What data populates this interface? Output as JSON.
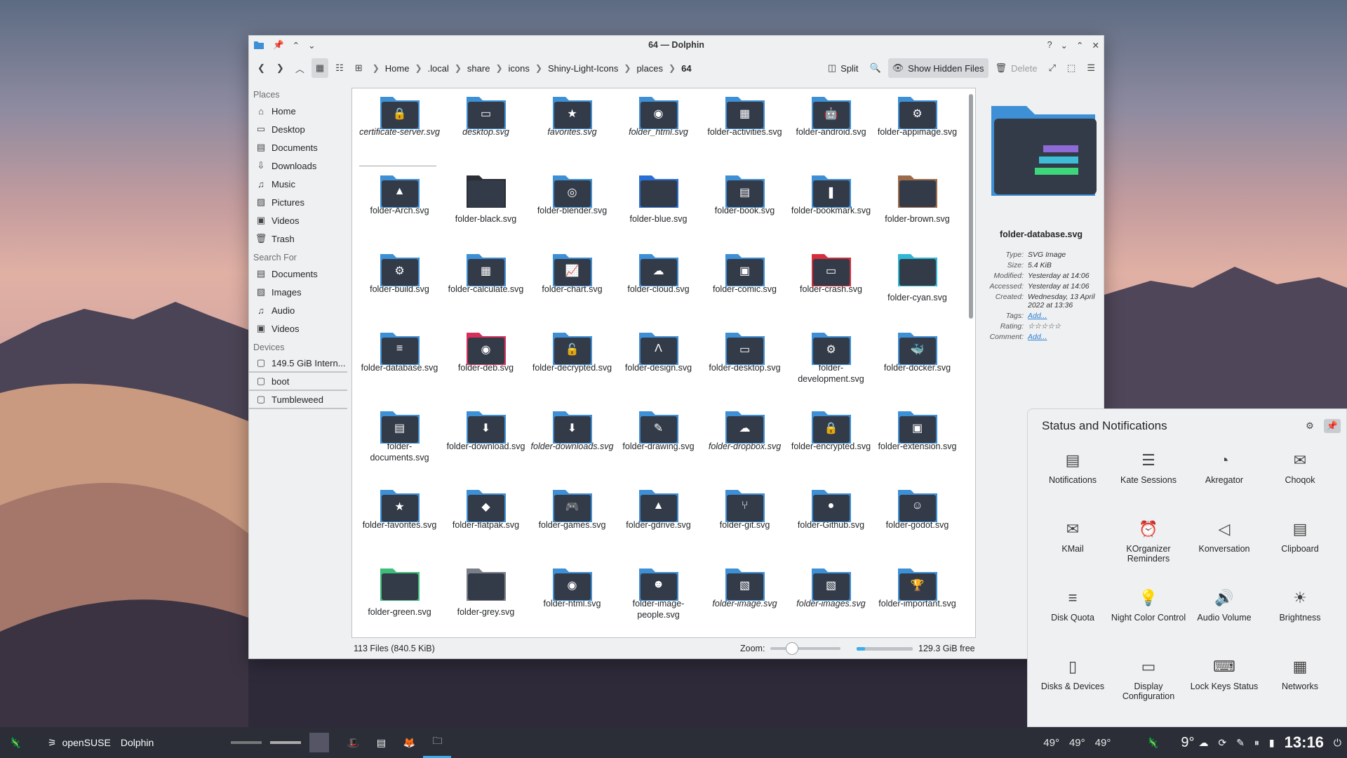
{
  "window": {
    "title": "64 — Dolphin"
  },
  "toolbar": {
    "breadcrumbs": [
      "Home",
      ".local",
      "share",
      "icons",
      "Shiny-Light-Icons",
      "places",
      "64"
    ],
    "split_label": "Split",
    "hidden_label": "Show Hidden Files",
    "delete_label": "Delete"
  },
  "sidebar": {
    "places_header": "Places",
    "places": [
      {
        "label": "Home",
        "icon": "home-icon"
      },
      {
        "label": "Desktop",
        "icon": "desktop-icon"
      },
      {
        "label": "Documents",
        "icon": "documents-icon"
      },
      {
        "label": "Downloads",
        "icon": "download-icon"
      },
      {
        "label": "Music",
        "icon": "music-icon"
      },
      {
        "label": "Pictures",
        "icon": "pictures-icon"
      },
      {
        "label": "Videos",
        "icon": "videos-icon"
      },
      {
        "label": "Trash",
        "icon": "trash-icon"
      }
    ],
    "search_header": "Search For",
    "search": [
      {
        "label": "Documents",
        "icon": "documents-icon"
      },
      {
        "label": "Images",
        "icon": "images-icon"
      },
      {
        "label": "Audio",
        "icon": "audio-icon"
      },
      {
        "label": "Videos",
        "icon": "videos-icon"
      }
    ],
    "devices_header": "Devices",
    "devices": [
      {
        "label": "149.5 GiB Intern..."
      },
      {
        "label": "boot"
      },
      {
        "label": "Tumbleweed"
      }
    ]
  },
  "files": [
    {
      "name": "certificate-server.svg",
      "italic": true,
      "color": "#3d8fd6",
      "glyph": "🔒"
    },
    {
      "name": "desktop.svg",
      "italic": true,
      "color": "#3d8fd6",
      "glyph": "▭"
    },
    {
      "name": "favorites.svg",
      "italic": true,
      "color": "#3d8fd6",
      "glyph": "★"
    },
    {
      "name": "folder_html.svg",
      "italic": true,
      "color": "#3d8fd6",
      "glyph": "◉"
    },
    {
      "name": "folder-activities.svg",
      "italic": false,
      "color": "#3d8fd6",
      "glyph": "▦"
    },
    {
      "name": "folder-android.svg",
      "italic": false,
      "color": "#3d8fd6",
      "glyph": "🤖"
    },
    {
      "name": "folder-appimage.svg",
      "italic": false,
      "color": "#3d8fd6",
      "glyph": "⚙"
    },
    {
      "name": "folder-Arch.svg",
      "italic": false,
      "color": "#3d8fd6",
      "glyph": "▲"
    },
    {
      "name": "folder-black.svg",
      "italic": false,
      "color": "#2b2e37",
      "glyph": ""
    },
    {
      "name": "folder-blender.svg",
      "italic": false,
      "color": "#3d8fd6",
      "glyph": "◎"
    },
    {
      "name": "folder-blue.svg",
      "italic": false,
      "color": "#2a6fd6",
      "glyph": ""
    },
    {
      "name": "folder-book.svg",
      "italic": false,
      "color": "#3d8fd6",
      "glyph": "▤"
    },
    {
      "name": "folder-bookmark.svg",
      "italic": false,
      "color": "#3d8fd6",
      "glyph": "❚"
    },
    {
      "name": "folder-brown.svg",
      "italic": false,
      "color": "#9b6b4a",
      "glyph": ""
    },
    {
      "name": "folder-build.svg",
      "italic": false,
      "color": "#3d8fd6",
      "glyph": "⚙"
    },
    {
      "name": "folder-calculate.svg",
      "italic": false,
      "color": "#3d8fd6",
      "glyph": "▦"
    },
    {
      "name": "folder-chart.svg",
      "italic": false,
      "color": "#3d8fd6",
      "glyph": "📈"
    },
    {
      "name": "folder-cloud.svg",
      "italic": false,
      "color": "#3d8fd6",
      "glyph": "☁"
    },
    {
      "name": "folder-comic.svg",
      "italic": false,
      "color": "#3d8fd6",
      "glyph": "▣"
    },
    {
      "name": "folder-crash.svg",
      "italic": false,
      "color": "#d62f3c",
      "glyph": "▭"
    },
    {
      "name": "folder-cyan.svg",
      "italic": false,
      "color": "#2fb8d6",
      "glyph": ""
    },
    {
      "name": "folder-database.svg",
      "italic": false,
      "color": "#3d8fd6",
      "glyph": "≡"
    },
    {
      "name": "folder-deb.svg",
      "italic": false,
      "color": "#d62f5a",
      "glyph": "◉"
    },
    {
      "name": "folder-decrypted.svg",
      "italic": false,
      "color": "#3d8fd6",
      "glyph": "🔓"
    },
    {
      "name": "folder-design.svg",
      "italic": false,
      "color": "#3d8fd6",
      "glyph": "Λ"
    },
    {
      "name": "folder-desktop.svg",
      "italic": false,
      "color": "#3d8fd6",
      "glyph": "▭"
    },
    {
      "name": "folder-development.svg",
      "italic": false,
      "color": "#3d8fd6",
      "glyph": "⚙"
    },
    {
      "name": "folder-docker.svg",
      "italic": false,
      "color": "#3d8fd6",
      "glyph": "🐳"
    },
    {
      "name": "folder-documents.svg",
      "italic": false,
      "color": "#3d8fd6",
      "glyph": "▤"
    },
    {
      "name": "folder-download.svg",
      "italic": false,
      "color": "#3d8fd6",
      "glyph": "⬇"
    },
    {
      "name": "folder-downloads.svg",
      "italic": true,
      "color": "#3d8fd6",
      "glyph": "⬇"
    },
    {
      "name": "folder-drawing.svg",
      "italic": false,
      "color": "#3d8fd6",
      "glyph": "✎"
    },
    {
      "name": "folder-dropbox.svg",
      "italic": true,
      "color": "#3d8fd6",
      "glyph": "☁"
    },
    {
      "name": "folder-encrypted.svg",
      "italic": false,
      "color": "#3d8fd6",
      "glyph": "🔒"
    },
    {
      "name": "folder-extension.svg",
      "italic": false,
      "color": "#3d8fd6",
      "glyph": "▣"
    },
    {
      "name": "folder-favorites.svg",
      "italic": false,
      "color": "#3d8fd6",
      "glyph": "★"
    },
    {
      "name": "folder-flatpak.svg",
      "italic": false,
      "color": "#3d8fd6",
      "glyph": "◆"
    },
    {
      "name": "folder-games.svg",
      "italic": false,
      "color": "#3d8fd6",
      "glyph": "🎮"
    },
    {
      "name": "folder-gdrive.svg",
      "italic": false,
      "color": "#3d8fd6",
      "glyph": "▲"
    },
    {
      "name": "folder-git.svg",
      "italic": false,
      "color": "#3d8fd6",
      "glyph": "⑂"
    },
    {
      "name": "folder-Github.svg",
      "italic": false,
      "color": "#3d8fd6",
      "glyph": "●"
    },
    {
      "name": "folder-godot.svg",
      "italic": false,
      "color": "#3d8fd6",
      "glyph": "☺"
    },
    {
      "name": "folder-green.svg",
      "italic": false,
      "color": "#3dbd7a",
      "glyph": ""
    },
    {
      "name": "folder-grey.svg",
      "italic": false,
      "color": "#7a7e86",
      "glyph": ""
    },
    {
      "name": "folder-html.svg",
      "italic": false,
      "color": "#3d8fd6",
      "glyph": "◉"
    },
    {
      "name": "folder-image-people.svg",
      "italic": false,
      "color": "#3d8fd6",
      "glyph": "☻"
    },
    {
      "name": "folder-image.svg",
      "italic": true,
      "color": "#3d8fd6",
      "glyph": "▧"
    },
    {
      "name": "folder-images.svg",
      "italic": true,
      "color": "#3d8fd6",
      "glyph": "▧"
    },
    {
      "name": "folder-important.svg",
      "italic": false,
      "color": "#3d8fd6",
      "glyph": "🏆"
    }
  ],
  "info": {
    "name": "folder-database.svg",
    "rows": [
      {
        "k": "Type:",
        "v": "SVG Image",
        "link": false
      },
      {
        "k": "Size:",
        "v": "5.4 KiB",
        "link": false
      },
      {
        "k": "Modified:",
        "v": "Yesterday at 14:06",
        "link": false
      },
      {
        "k": "Accessed:",
        "v": "Yesterday at 14:06",
        "link": false
      },
      {
        "k": "Created:",
        "v": "Wednesday, 13 April 2022 at 13:36",
        "link": false
      },
      {
        "k": "Tags:",
        "v": "Add...",
        "link": true
      },
      {
        "k": "Rating:",
        "v": "☆☆☆☆☆",
        "link": false
      },
      {
        "k": "Comment:",
        "v": "Add...",
        "link": true
      }
    ]
  },
  "statusbar": {
    "count": "113 Files (840.5 KiB)",
    "zoom_label": "Zoom:",
    "free": "129.3 GiB free",
    "free_used_fraction": 0.15
  },
  "notifications": {
    "title": "Status and Notifications",
    "items": [
      {
        "label": "Notifications",
        "icon": "notifications-icon",
        "glyph": "▤"
      },
      {
        "label": "Kate Sessions",
        "icon": "kate-icon",
        "glyph": "☰"
      },
      {
        "label": "Akregator",
        "icon": "rss-icon",
        "glyph": "◔"
      },
      {
        "label": "Choqok",
        "icon": "choqok-icon",
        "glyph": "✉"
      },
      {
        "label": "KMail",
        "icon": "mail-icon",
        "glyph": "✉"
      },
      {
        "label": "KOrganizer Reminders",
        "icon": "alarm-icon",
        "glyph": "⏰"
      },
      {
        "label": "Konversation",
        "icon": "konversation-icon",
        "glyph": "◁"
      },
      {
        "label": "Clipboard",
        "icon": "clipboard-icon",
        "glyph": "▤"
      },
      {
        "label": "Disk Quota",
        "icon": "disk-quota-icon",
        "glyph": "≡"
      },
      {
        "label": "Night Color Control",
        "icon": "night-color-icon",
        "glyph": "💡"
      },
      {
        "label": "Audio Volume",
        "icon": "volume-icon",
        "glyph": "🔊"
      },
      {
        "label": "Brightness",
        "icon": "brightness-icon",
        "glyph": "☀"
      },
      {
        "label": "Disks & Devices",
        "icon": "usb-icon",
        "glyph": "▯"
      },
      {
        "label": "Display Configuration",
        "icon": "display-icon",
        "glyph": "▭"
      },
      {
        "label": "Lock Keys Status",
        "icon": "keyboard-icon",
        "glyph": "⌨"
      },
      {
        "label": "Networks",
        "icon": "network-icon",
        "glyph": "▦"
      }
    ]
  },
  "taskbar": {
    "distro": "openSUSE",
    "app": "Dolphin",
    "temps": [
      "49°",
      "49°",
      "49°"
    ],
    "weather": "9°",
    "clock": "13:16"
  }
}
